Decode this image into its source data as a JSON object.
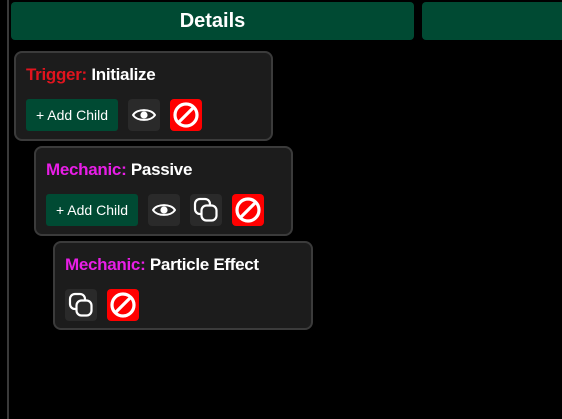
{
  "tabs": {
    "details_label": "Details"
  },
  "cards": [
    {
      "type_label": "Trigger:",
      "name": "Initialize",
      "add_child_label": "+ Add Child"
    },
    {
      "type_label": "Mechanic:",
      "name": "Passive",
      "add_child_label": "+ Add Child"
    },
    {
      "type_label": "Mechanic:",
      "name": "Particle Effect"
    }
  ],
  "colors": {
    "trigger": "#e0141e",
    "mechanic": "#e81ee6",
    "accent_green": "#004a33",
    "delete_red": "#ff0000"
  },
  "icons": [
    "eye-icon",
    "copy-icon",
    "no-entry-icon"
  ]
}
